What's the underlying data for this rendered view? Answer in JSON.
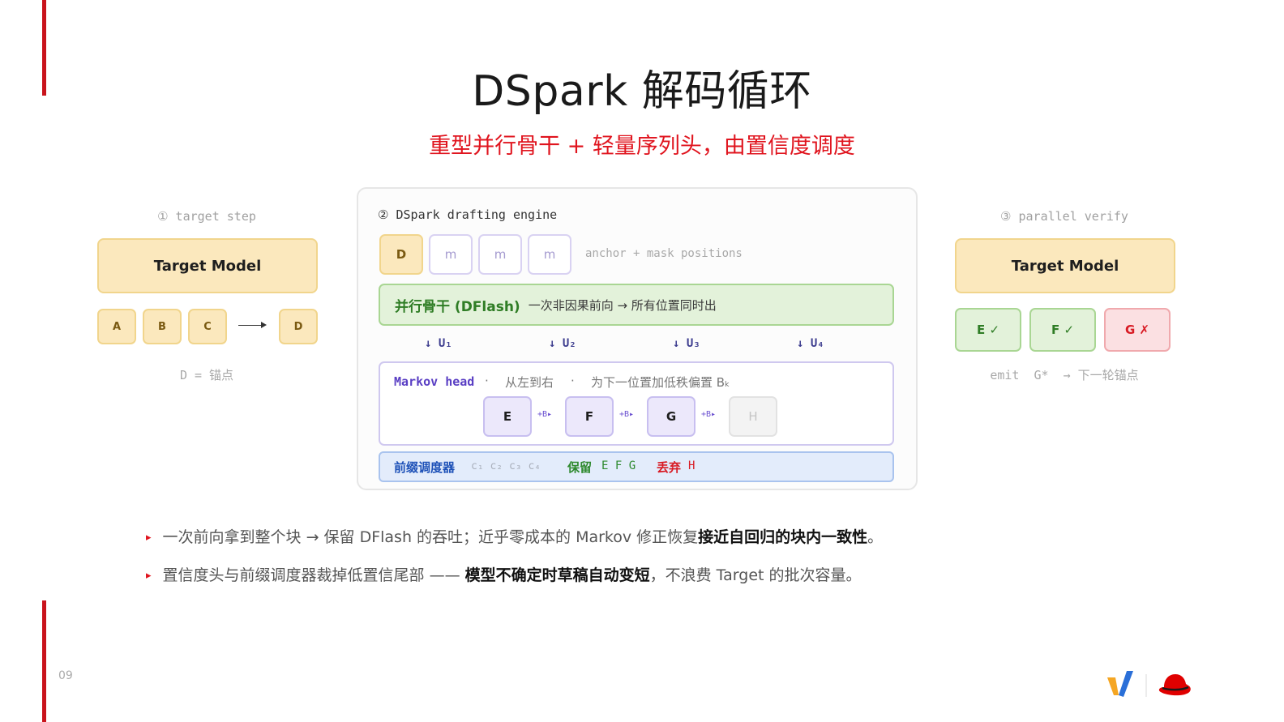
{
  "title": "DSpark 解码循环",
  "subtitle": "重型并行骨干 + 轻量序列头，由置信度调度",
  "left_panel": {
    "step_label": "① target step",
    "model_label": "Target Model",
    "tokens": [
      "A",
      "B",
      "C"
    ],
    "output_token": "D",
    "note": "D = 锚点"
  },
  "engine": {
    "label": "② DSpark drafting engine",
    "anchor": "D",
    "masks": [
      "m",
      "m",
      "m"
    ],
    "mask_note": "anchor + mask positions",
    "backbone_main": "并行骨干 (DFlash)",
    "backbone_sub": "一次非因果前向 → 所有位置同时出",
    "u_labels": [
      "↓ U₁",
      "↓ U₂",
      "↓ U₃",
      "↓ U₄"
    ],
    "markov_title": "Markov head",
    "markov_dot1": "·",
    "markov_text1": "从左到右",
    "markov_dot2": "·",
    "markov_text2": "为下一位置加低秩偏置 Bₖ",
    "markov_tokens": [
      "E",
      "F",
      "G",
      "H"
    ],
    "bias_label": "+B▸",
    "scheduler_label": "前缀调度器",
    "confidences": "c₁ c₂ c₃ c₄",
    "keep_label": "保留",
    "keep_tokens": "E F G",
    "drop_label": "丢弃",
    "drop_tokens": "H"
  },
  "right_panel": {
    "step_label": "③ parallel verify",
    "model_label": "Target Model",
    "verdicts": [
      {
        "label": "E ✓",
        "status": "accepted"
      },
      {
        "label": "F ✓",
        "status": "accepted"
      },
      {
        "label": "G ✗",
        "status": "rejected"
      }
    ],
    "note": "emit  G*  → 下一轮锚点"
  },
  "bullets": [
    {
      "pre": "一次前向拿到整个块 → 保留 DFlash 的吞吐；近乎零成本的 Markov 修正恢复",
      "bold": "接近自回归的块内一致性",
      "post": "。"
    },
    {
      "pre": "置信度头与前缀调度器裁掉低置信尾部 —— ",
      "bold": "模型不确定时草稿自动变短",
      "post": "，不浪费 Target 的批次容量。"
    }
  ],
  "page_number": "09",
  "colors": {
    "accent_red": "#e0141e",
    "bar_red": "#c9141c",
    "token_yellow": "#fbe8bd",
    "backbone_green": "#e3f2da",
    "markov_purple": "#5a3fc4",
    "scheduler_blue": "#e3ecfb"
  }
}
